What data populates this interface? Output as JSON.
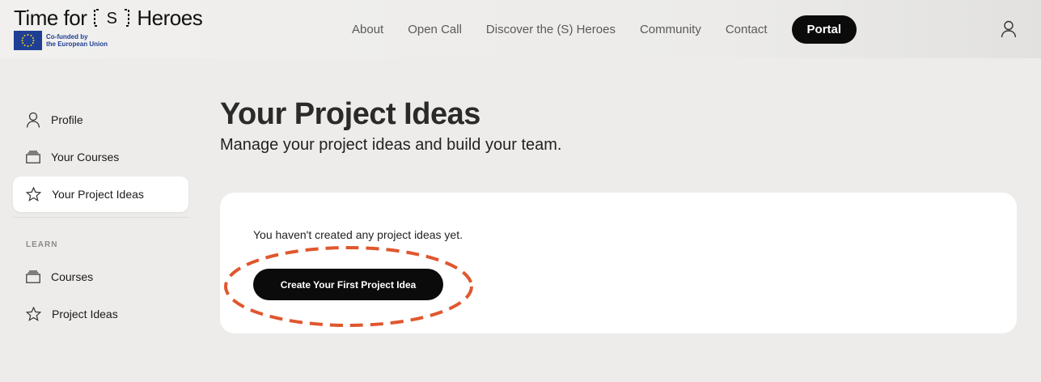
{
  "brand": {
    "title_left": "Time for",
    "title_mark": "(S)",
    "title_right": "Heroes",
    "eu_line1": "Co-funded by",
    "eu_line2": "the European Union"
  },
  "nav": {
    "items": [
      "About",
      "Open Call",
      "Discover the (S) Heroes",
      "Community",
      "Contact"
    ],
    "portal_label": "Portal",
    "user_icon": "user-icon"
  },
  "sidebar": {
    "items": [
      {
        "label": "Profile",
        "icon": "user-icon",
        "active": false
      },
      {
        "label": "Your Courses",
        "icon": "stack-icon",
        "active": false
      },
      {
        "label": "Your Project Ideas",
        "icon": "star-icon",
        "active": true
      }
    ],
    "section_label": "LEARN",
    "learn_items": [
      {
        "label": "Courses",
        "icon": "stack-icon"
      },
      {
        "label": "Project Ideas",
        "icon": "star-icon"
      }
    ]
  },
  "main": {
    "title": "Your Project Ideas",
    "subtitle": "Manage your project ideas and build your team.",
    "empty_message": "You haven't created any project ideas yet.",
    "create_button": "Create Your First Project Idea"
  },
  "colors": {
    "background": "#edecea",
    "card": "#ffffff",
    "button": "#0b0b0b",
    "highlight": "#e0572e",
    "eu_blue": "#1f3f95"
  }
}
